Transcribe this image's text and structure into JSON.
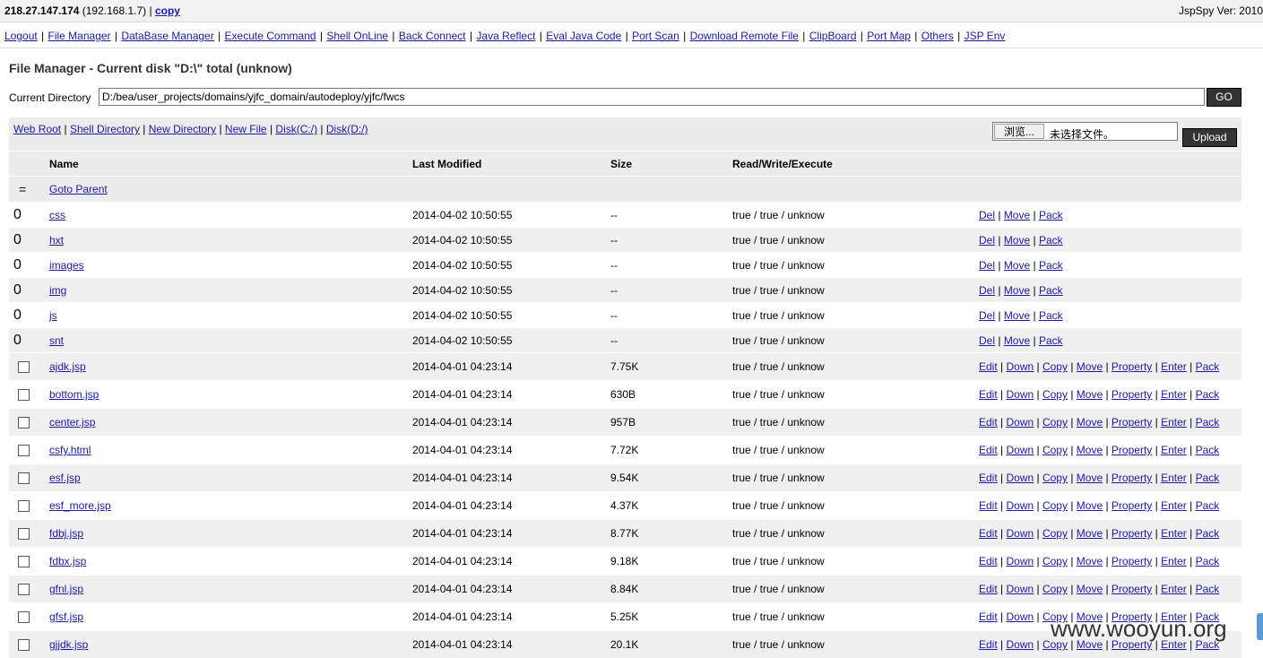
{
  "topbar": {
    "ip": "218.27.147.174",
    "local_ip": " (192.168.1.7) ",
    "copy_label": "copy",
    "version": "JspSpy Ver: 2010"
  },
  "nav": [
    "Logout",
    "File Manager",
    "DataBase Manager",
    "Execute Command",
    "Shell OnLine",
    "Back Connect",
    "Java Reflect",
    "Eval Java Code",
    "Port Scan",
    "Download Remote File",
    "ClipBoard",
    "Port Map",
    "Others",
    "JSP Env"
  ],
  "heading": "File Manager - Current disk \"D:\\\" total (unknow)",
  "current_dir": {
    "label": "Current Directory",
    "value": "D:/bea/user_projects/domains/yjfc_domain/autodeploy/yjfc/fwcs",
    "go_label": "GO"
  },
  "toolbar": {
    "links": [
      "Web Root",
      "Shell Directory",
      "New Directory",
      "New File",
      "Disk(C:/)",
      "Disk(D:/)"
    ],
    "browse_label": "浏览...",
    "no_file": "未选择文件。",
    "upload_label": "Upload"
  },
  "columns": {
    "name": "Name",
    "modified": "Last Modified",
    "size": "Size",
    "rwx": "Read/Write/Execute"
  },
  "parent": {
    "symbol": "=",
    "label": "Goto Parent"
  },
  "dir_actions": [
    "Del",
    "Move",
    "Pack"
  ],
  "file_actions": [
    "Edit",
    "Down",
    "Copy",
    "Move",
    "Property",
    "Enter",
    "Pack"
  ],
  "dirs": [
    {
      "marker": "0",
      "name": "css",
      "modified": "2014-04-02 10:50:55",
      "size": "--",
      "rwx": "true / true / unknow"
    },
    {
      "marker": "0",
      "name": "hxt",
      "modified": "2014-04-02 10:50:55",
      "size": "--",
      "rwx": "true / true / unknow"
    },
    {
      "marker": "0",
      "name": "images",
      "modified": "2014-04-02 10:50:55",
      "size": "--",
      "rwx": "true / true / unknow"
    },
    {
      "marker": "0",
      "name": "img",
      "modified": "2014-04-02 10:50:55",
      "size": "--",
      "rwx": "true / true / unknow"
    },
    {
      "marker": "0",
      "name": "js",
      "modified": "2014-04-02 10:50:55",
      "size": "--",
      "rwx": "true / true / unknow"
    },
    {
      "marker": "0",
      "name": "snt",
      "modified": "2014-04-02 10:50:55",
      "size": "--",
      "rwx": "true / true / unknow"
    }
  ],
  "files": [
    {
      "name": "ajdk.jsp",
      "modified": "2014-04-01 04:23:14",
      "size": "7.75K",
      "rwx": "true / true / unknow"
    },
    {
      "name": "bottom.jsp",
      "modified": "2014-04-01 04:23:14",
      "size": "630B",
      "rwx": "true / true / unknow"
    },
    {
      "name": "center.jsp",
      "modified": "2014-04-01 04:23:14",
      "size": "957B",
      "rwx": "true / true / unknow"
    },
    {
      "name": "csfy.html",
      "modified": "2014-04-01 04:23:14",
      "size": "7.72K",
      "rwx": "true / true / unknow"
    },
    {
      "name": "esf.jsp",
      "modified": "2014-04-01 04:23:14",
      "size": "9.54K",
      "rwx": "true / true / unknow"
    },
    {
      "name": "esf_more.jsp",
      "modified": "2014-04-01 04:23:14",
      "size": "4.37K",
      "rwx": "true / true / unknow"
    },
    {
      "name": "fdbj.jsp",
      "modified": "2014-04-01 04:23:14",
      "size": "8.77K",
      "rwx": "true / true / unknow"
    },
    {
      "name": "fdbx.jsp",
      "modified": "2014-04-01 04:23:14",
      "size": "9.18K",
      "rwx": "true / true / unknow"
    },
    {
      "name": "gfnl.jsp",
      "modified": "2014-04-01 04:23:14",
      "size": "8.84K",
      "rwx": "true / true / unknow"
    },
    {
      "name": "gfsf.jsp",
      "modified": "2014-04-01 04:23:14",
      "size": "5.25K",
      "rwx": "true / true / unknow"
    },
    {
      "name": "gjjdk.jsp",
      "modified": "2014-04-01 04:23:14",
      "size": "20.1K",
      "rwx": "true / true / unknow"
    }
  ],
  "watermark": "www.wooyun.org"
}
